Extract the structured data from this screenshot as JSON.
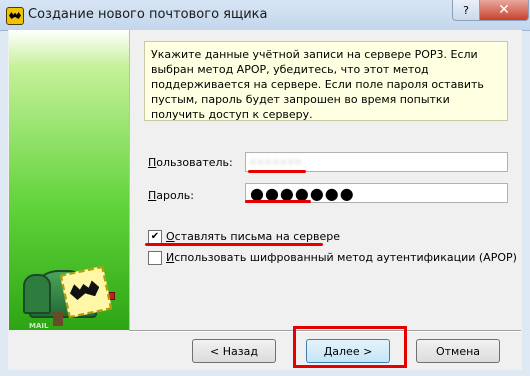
{
  "window": {
    "title": "Создание нового почтового ящика",
    "help_label": "?",
    "close_label": "✕"
  },
  "info_text": "Укажите данные учётной записи на сервере POP3. Если выбран метод APOP, убедитесь, что этот метод поддерживается на сервере. Если поле пароля оставить пустым, пароль будет запрошен во время попытки получить доступ к серверу.",
  "form": {
    "user_label_accel": "П",
    "user_label_rest": "ользователь:",
    "user_value": "•••••••",
    "password_label_accel": "П",
    "password_label_rest": "ароль:",
    "password_value": "●●●●●●●",
    "leave_on_server_accel": "О",
    "leave_on_server_rest": "ставлять письма на сервере",
    "leave_on_server_checked": true,
    "apop_accel": "И",
    "apop_rest": "спользовать шифрованный метод аутентификации (APOP)",
    "apop_checked": false,
    "checkmark": "✔"
  },
  "buttons": {
    "back": "< Назад",
    "next": "Далее >",
    "cancel": "Отмена"
  },
  "sidebar": {
    "mailbox_text": "MAIL"
  },
  "colors": {
    "highlight": "#e60000"
  }
}
